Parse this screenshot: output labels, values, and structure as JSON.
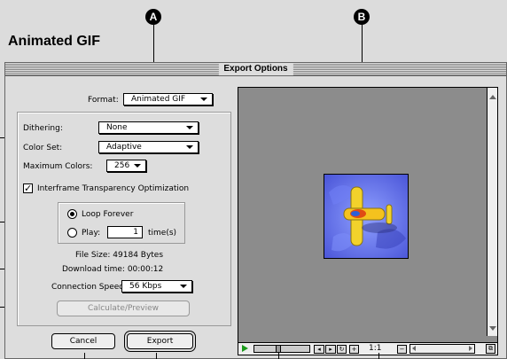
{
  "callouts": {
    "a": "A",
    "b": "B"
  },
  "section_title": "Animated GIF",
  "dialog": {
    "title": "Export Options",
    "format_label": "Format:",
    "format_value": "Animated GIF",
    "dithering_label": "Dithering:",
    "dithering_value": "None",
    "color_set_label": "Color Set:",
    "color_set_value": "Adaptive",
    "max_colors_label": "Maximum Colors:",
    "max_colors_value": "256",
    "interframe_label": "Interframe Transparency Optimization",
    "interframe_checked": "✓",
    "loop_forever_label": "Loop Forever",
    "play_label": "Play:",
    "play_value": "1",
    "times_label": "time(s)",
    "file_size": "File Size: 49184 Bytes",
    "download_time": "Download time: 00:00:12",
    "connection_label": "Connection Speed:",
    "connection_value": "56 Kbps",
    "calculate_button": "Calculate/Preview",
    "cancel_button": "Cancel",
    "export_button": "Export"
  },
  "preview": {
    "zoom": "1:1"
  }
}
